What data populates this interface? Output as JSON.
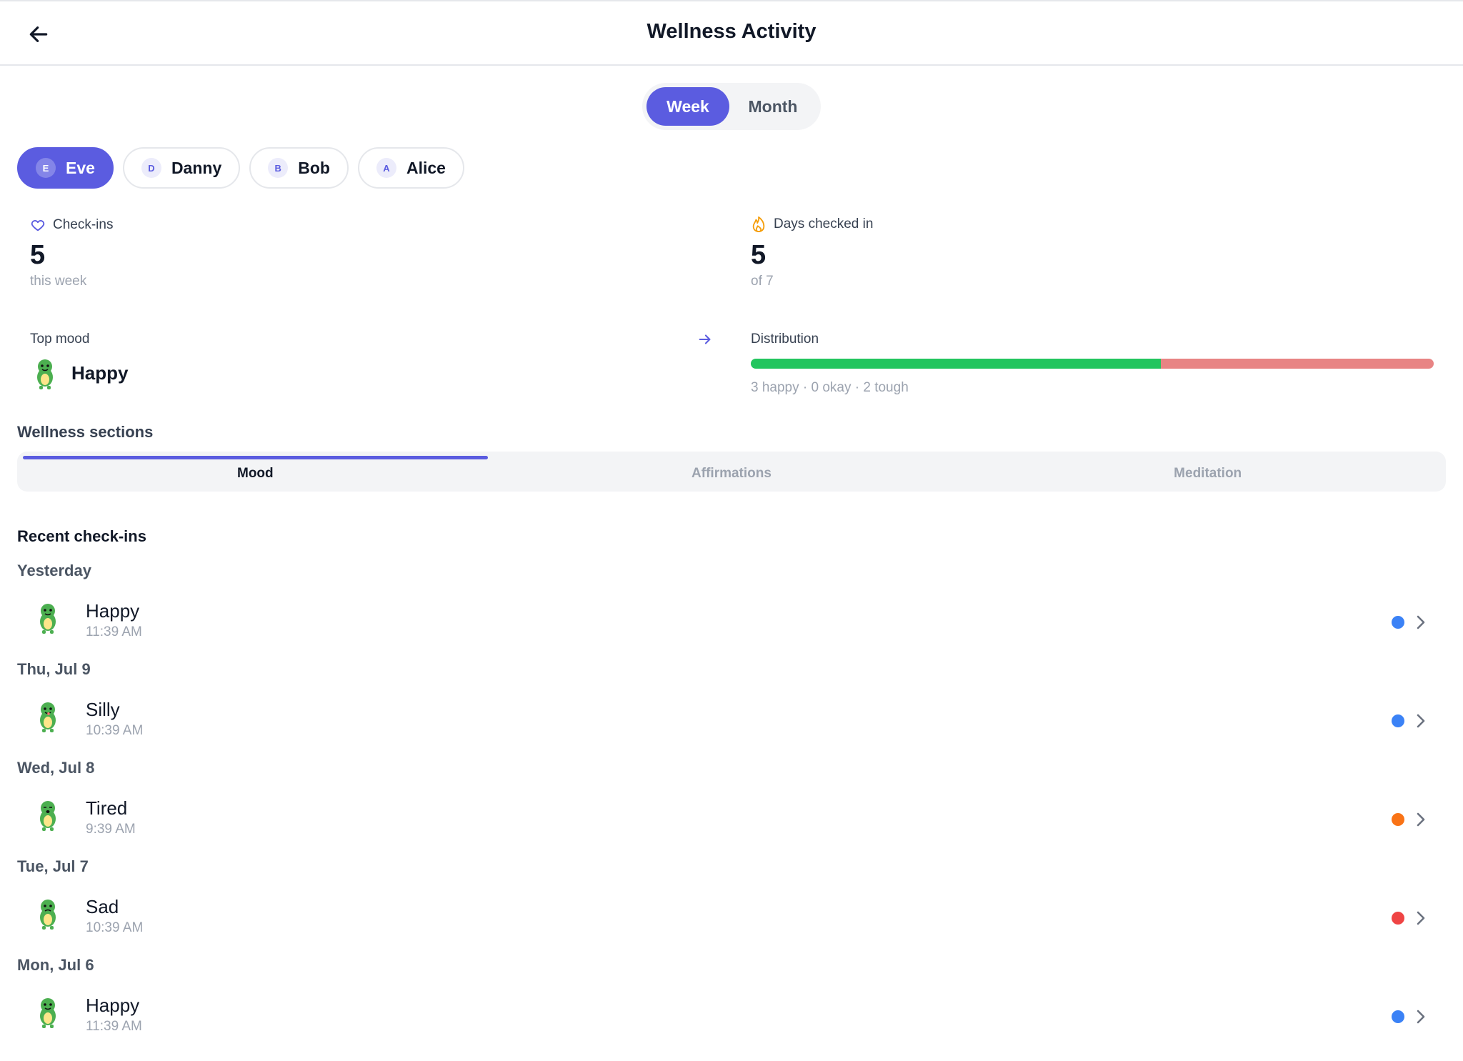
{
  "header": {
    "title": "Wellness Activity",
    "back_icon": "arrow-left-icon"
  },
  "period_toggle": {
    "options": [
      "Week",
      "Month"
    ],
    "selected": "Week"
  },
  "users": [
    {
      "initial": "E",
      "name": "Eve",
      "selected": true
    },
    {
      "initial": "D",
      "name": "Danny",
      "selected": false
    },
    {
      "initial": "B",
      "name": "Bob",
      "selected": false
    },
    {
      "initial": "A",
      "name": "Alice",
      "selected": false
    }
  ],
  "stats": {
    "checkins": {
      "label": "Check-ins",
      "value": "5",
      "sub": "this week",
      "icon": "heart-icon"
    },
    "days": {
      "label": "Days checked in",
      "value": "5",
      "sub": "of 7",
      "icon": "flame-icon"
    },
    "top_mood": {
      "label": "Top mood",
      "value": "Happy",
      "arrow_icon": "arrow-right-icon"
    },
    "distribution": {
      "label": "Distribution",
      "summary": "3 happy · 0 okay · 2 tough",
      "happy": 3,
      "okay": 0,
      "tough": 2,
      "colors": {
        "happy": "#22c55e",
        "okay": "#f59e0b",
        "tough": "#e88484"
      }
    }
  },
  "sections": {
    "title": "Wellness sections",
    "tabs": [
      "Mood",
      "Affirmations",
      "Meditation"
    ],
    "active": "Mood"
  },
  "recent": {
    "title": "Recent check-ins",
    "groups": [
      {
        "day": "Yesterday",
        "entries": [
          {
            "mood": "Happy",
            "time": "11:39 AM",
            "dot": "#3b82f6"
          }
        ]
      },
      {
        "day": "Thu, Jul 9",
        "entries": [
          {
            "mood": "Silly",
            "time": "10:39 AM",
            "dot": "#3b82f6"
          }
        ]
      },
      {
        "day": "Wed, Jul 8",
        "entries": [
          {
            "mood": "Tired",
            "time": "9:39 AM",
            "dot": "#f97316"
          }
        ]
      },
      {
        "day": "Tue, Jul 7",
        "entries": [
          {
            "mood": "Sad",
            "time": "10:39 AM",
            "dot": "#ef4444"
          }
        ]
      },
      {
        "day": "Mon, Jul 6",
        "entries": [
          {
            "mood": "Happy",
            "time": "11:39 AM",
            "dot": "#3b82f6"
          }
        ]
      }
    ]
  },
  "accent": "#5b5ce0"
}
